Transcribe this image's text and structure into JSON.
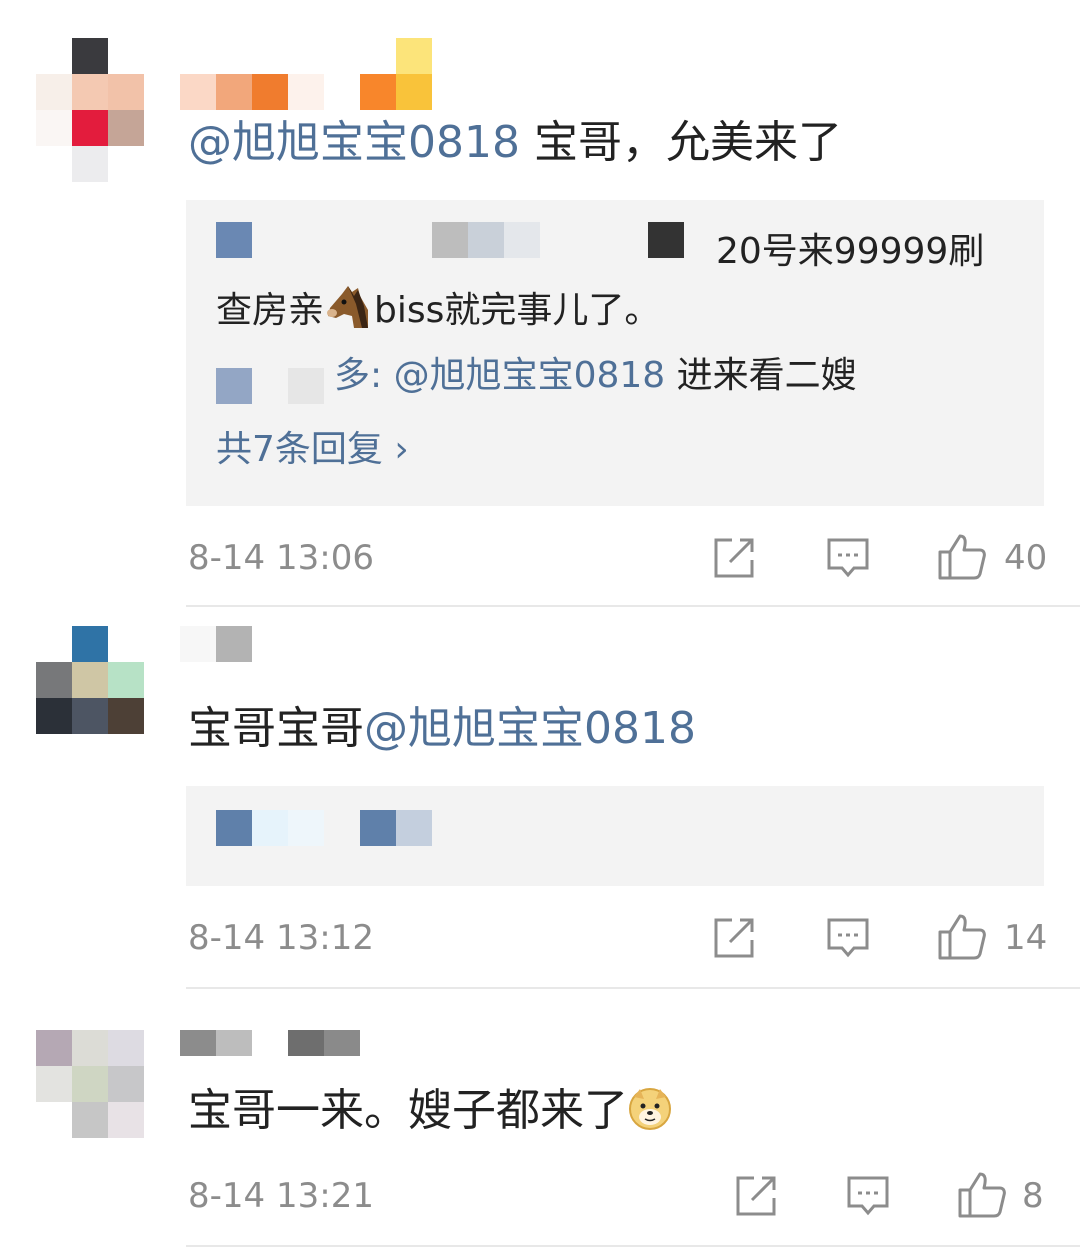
{
  "comments": [
    {
      "mention": "@旭旭宝宝0818",
      "text": " 宝哥，允美来了",
      "replies": {
        "reply1_text": "20号来99999刷",
        "reply1_text_line2": "查房亲",
        "reply1_text_line2b": "biss就完事儿了。",
        "reply2_prefix": "多: ",
        "reply2_mention": "@旭旭宝宝0818",
        "reply2_text": "  进来看二嫂",
        "more": "共7条回复 ›"
      },
      "time": "8-14 13:06",
      "likes": "40"
    },
    {
      "text": "宝哥宝哥",
      "mention": "@旭旭宝宝0818",
      "time": "8-14 13:12",
      "likes": "14"
    },
    {
      "text": "宝哥一来。嫂子都来了",
      "time": "8-14 13:21",
      "likes": "8"
    }
  ],
  "icons": {
    "share": "share-icon",
    "comment": "comment-icon",
    "like": "thumbs-up-icon",
    "horse": "horse-emoji",
    "doge": "doge-emoji"
  },
  "colors": {
    "mention": "#4f7097",
    "meta": "#8c8c8c",
    "reply_bg": "#f3f3f3"
  }
}
